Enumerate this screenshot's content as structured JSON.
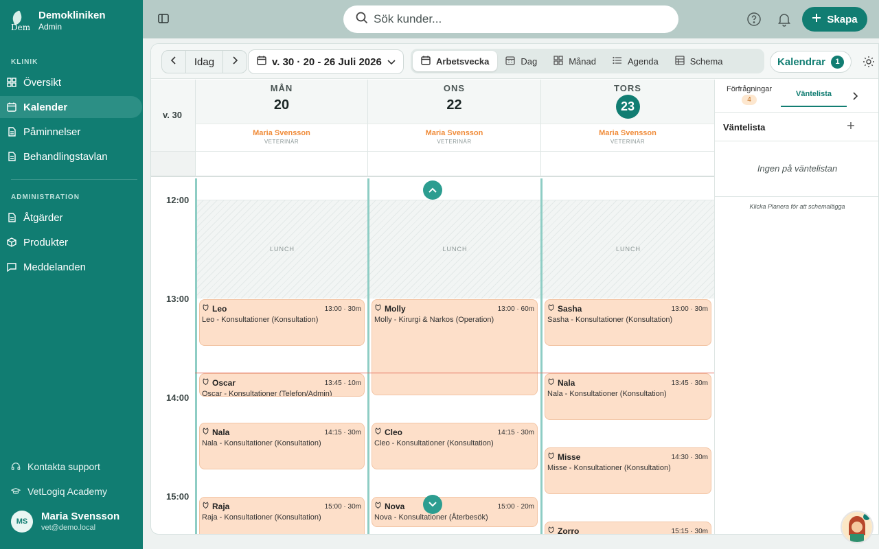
{
  "sidebar": {
    "brand_name": "Demokliniken",
    "brand_role": "Admin",
    "logo_text": "Dem",
    "section_klinik": "KLINIK",
    "items_klinik": [
      {
        "label": "Översikt",
        "icon": "grid-icon"
      },
      {
        "label": "Kalender",
        "icon": "calendar-icon",
        "active": true
      },
      {
        "label": "Påminnelser",
        "icon": "document-icon"
      },
      {
        "label": "Behandlingstavlan",
        "icon": "document-icon"
      }
    ],
    "section_admin": "ADMINISTRATION",
    "items_admin": [
      {
        "label": "Åtgärder",
        "icon": "document-icon"
      },
      {
        "label": "Produkter",
        "icon": "box-icon"
      },
      {
        "label": "Meddelanden",
        "icon": "message-icon"
      }
    ],
    "support": "Kontakta support",
    "academy": "VetLogiq Academy",
    "user": {
      "initials": "MS",
      "name": "Maria Svensson",
      "email": "vet@demo.local"
    }
  },
  "topbar": {
    "search_placeholder": "Sök kunder...",
    "create_label": "Skapa"
  },
  "toolbar": {
    "today_label": "Idag",
    "week_range": "v. 30 · 20 - 26 Juli 2026",
    "views": [
      {
        "label": "Arbetsvecka",
        "icon": "calendar-icon",
        "active": true
      },
      {
        "label": "Dag",
        "icon": "calendar-grid-icon"
      },
      {
        "label": "Månad",
        "icon": "grid-icon"
      },
      {
        "label": "Agenda",
        "icon": "list-icon"
      },
      {
        "label": "Schema",
        "icon": "table-icon"
      }
    ],
    "calendars_label": "Kalendrar",
    "calendars_count": "1"
  },
  "calendar": {
    "week_label": "v. 30",
    "days": [
      {
        "name": "MÅN",
        "num": "20",
        "today": false,
        "staff": "Maria Svensson",
        "role": "VETERINÄR"
      },
      {
        "name": "ONS",
        "num": "22",
        "today": false,
        "staff": "Maria Svensson",
        "role": "VETERINÄR"
      },
      {
        "name": "TORS",
        "num": "23",
        "today": true,
        "staff": "Maria Svensson",
        "role": "VETERINÄR"
      }
    ],
    "time_labels": [
      "12:00",
      "13:00",
      "14:00",
      "15:00"
    ],
    "lunch_label": "LUNCH",
    "appointments": [
      [
        {
          "name": "Leo",
          "time": "13:00 · 30m",
          "desc": "Leo - Konsultationer (Konsultation)",
          "start_min": 780,
          "dur": 30
        },
        {
          "name": "Oscar",
          "time": "13:45 · 10m",
          "desc": "Oscar - Konsultationer (Telefon/Admin)",
          "start_min": 825,
          "dur": 10
        },
        {
          "name": "Nala",
          "time": "14:15 · 30m",
          "desc": "Nala - Konsultationer (Konsultation)",
          "start_min": 855,
          "dur": 30
        },
        {
          "name": "Raja",
          "time": "15:00 · 30m",
          "desc": "Raja - Konsultationer (Konsultation)",
          "start_min": 900,
          "dur": 30
        }
      ],
      [
        {
          "name": "Molly",
          "time": "13:00 · 60m",
          "desc": "Molly - Kirurgi & Narkos (Operation)",
          "start_min": 780,
          "dur": 60
        },
        {
          "name": "Cleo",
          "time": "14:15 · 30m",
          "desc": "Cleo - Konsultationer (Konsultation)",
          "start_min": 855,
          "dur": 30
        },
        {
          "name": "Nova",
          "time": "15:00 · 20m",
          "desc": "Nova - Konsultationer (Återbesök)",
          "start_min": 900,
          "dur": 20
        }
      ],
      [
        {
          "name": "Sasha",
          "time": "13:00 · 30m",
          "desc": "Sasha - Konsultationer (Konsultation)",
          "start_min": 780,
          "dur": 30
        },
        {
          "name": "Nala",
          "time": "13:45 · 30m",
          "desc": "Nala - Konsultationer (Konsultation)",
          "start_min": 825,
          "dur": 30
        },
        {
          "name": "Misse",
          "time": "14:30 · 30m",
          "desc": "Misse - Konsultationer (Konsultation)",
          "start_min": 870,
          "dur": 30
        },
        {
          "name": "Zorro",
          "time": "15:15 · 30m",
          "desc": "",
          "start_min": 915,
          "dur": 30
        }
      ]
    ]
  },
  "rightpanel": {
    "tab_requests": "Förfrågningar",
    "requests_count": "4",
    "tab_waitlist": "Väntelista",
    "title": "Väntelista",
    "empty_text": "Ingen på väntelistan",
    "hint": "Klicka Planera för att schemalägga"
  },
  "colors": {
    "primary": "#117d72",
    "appointment_bg": "#fddfc9",
    "staff_orange": "#f08c3a"
  }
}
